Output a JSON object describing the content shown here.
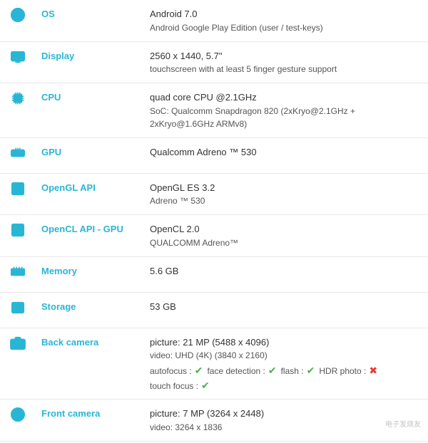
{
  "rows": [
    {
      "id": "os",
      "label": "OS",
      "icon": "os",
      "value_main": "Android 7.0",
      "value_sub": "Android Google Play Edition (user / test-keys)"
    },
    {
      "id": "display",
      "label": "Display",
      "icon": "display",
      "value_main": "2560 x 1440, 5.7\"",
      "value_sub": "touchscreen with at least 5 finger gesture support"
    },
    {
      "id": "cpu",
      "label": "CPU",
      "icon": "cpu",
      "value_main": "quad core CPU @2.1GHz",
      "value_sub": "SoC: Qualcomm Snapdragon 820 (2xKryo@2.1GHz + 2xKryo@1.6GHz ARMv8)"
    },
    {
      "id": "gpu",
      "label": "GPU",
      "icon": "gpu",
      "value_main": "Qualcomm Adreno ™ 530",
      "value_sub": ""
    },
    {
      "id": "opengl",
      "label": "OpenGL API",
      "icon": "opengl",
      "value_main": "OpenGL ES 3.2",
      "value_sub": "Adreno ™ 530"
    },
    {
      "id": "opencl",
      "label": "OpenCL API - GPU",
      "icon": "opencl",
      "value_main": "OpenCL 2.0",
      "value_sub": "QUALCOMM Adreno™"
    },
    {
      "id": "memory",
      "label": "Memory",
      "icon": "memory",
      "value_main": "5.6 GB",
      "value_sub": ""
    },
    {
      "id": "storage",
      "label": "Storage",
      "icon": "storage",
      "value_main": "53 GB",
      "value_sub": ""
    },
    {
      "id": "backcamera",
      "label": "Back camera",
      "icon": "camera",
      "value_main": "picture: 21 MP (5488 x 4096)",
      "value_sub": "video: UHD (4K) (3840 x 2160)",
      "features": [
        {
          "label": "autofocus :",
          "check": true
        },
        {
          "label": "face detection :",
          "check": true
        },
        {
          "label": "flash :",
          "check": true
        },
        {
          "label": "HDR photo :",
          "check": false
        }
      ],
      "features2": [
        {
          "label": "touch focus :",
          "check": true
        }
      ]
    },
    {
      "id": "frontcamera",
      "label": "Front camera",
      "icon": "frontcamera",
      "value_main": "picture: 7 MP (3264 x 2448)",
      "value_sub": "video: 3264 x 1836"
    }
  ],
  "watermark": "电子发烧友"
}
